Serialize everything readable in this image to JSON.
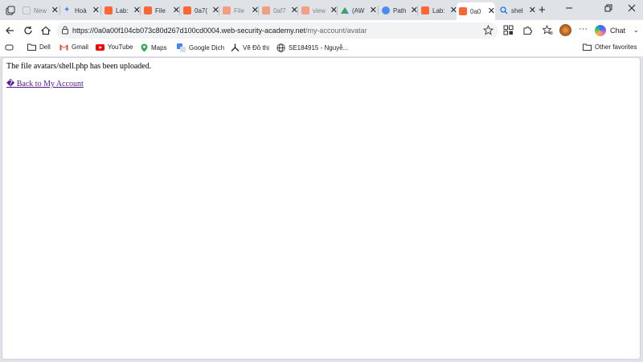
{
  "tabs": [
    {
      "title": "New",
      "favicon": "newtab-icon",
      "color": "#9aa0a6"
    },
    {
      "title": "Hoà",
      "favicon": "gemini-icon",
      "color": "#4b7cf3"
    },
    {
      "title": "Lab:",
      "favicon": "portswigger-icon",
      "color": "#ff6633"
    },
    {
      "title": "File",
      "favicon": "portswigger-icon",
      "color": "#ff6633"
    },
    {
      "title": "0a7(",
      "favicon": "portswigger-icon",
      "color": "#ff6633"
    },
    {
      "title": "File",
      "favicon": "portswigger-icon",
      "color": "#ff6633"
    },
    {
      "title": "0af7",
      "favicon": "portswigger-icon",
      "color": "#ff6633"
    },
    {
      "title": "view",
      "favicon": "portswigger-icon",
      "color": "#ff6633"
    },
    {
      "title": "(AW",
      "favicon": "drive-icon",
      "color": "#34a853"
    },
    {
      "title": "Path",
      "favicon": "pathfinder-icon",
      "color": "#4c8bf5"
    },
    {
      "title": "Lab:",
      "favicon": "portswigger-icon",
      "color": "#ff6633"
    },
    {
      "title": "0a0",
      "favicon": "portswigger-icon",
      "color": "#ff6633"
    },
    {
      "title": "shel",
      "favicon": "search-icon",
      "color": "#1a73e8"
    }
  ],
  "address": {
    "host": "https://0a0a00f104cb073c80d267d100cd0004.web-security-academy.net",
    "path": "/my-account/avatar"
  },
  "toolbar": {
    "chat_label": "Chat"
  },
  "bookmarks": [
    {
      "label": "Dell",
      "icon": "folder-icon"
    },
    {
      "label": "Gmail",
      "icon": "gmail-icon"
    },
    {
      "label": "YouTube",
      "icon": "youtube-icon"
    },
    {
      "label": "Maps",
      "icon": "maps-icon"
    },
    {
      "label": "Google Dịch",
      "icon": "translate-icon"
    },
    {
      "label": "Vẽ Đồ thị",
      "icon": "graph-icon"
    },
    {
      "label": "SE184915 - Nguyễ...",
      "icon": "globe-icon"
    }
  ],
  "other_favorites": "Other favorites",
  "page": {
    "message": "The file avatars/shell.php has been uploaded.",
    "back_link": "� Back to My Account"
  },
  "colors": {
    "link": "#551a8b",
    "portswigger": "#ff6633",
    "chrome_bg": "#dfe3e8"
  }
}
